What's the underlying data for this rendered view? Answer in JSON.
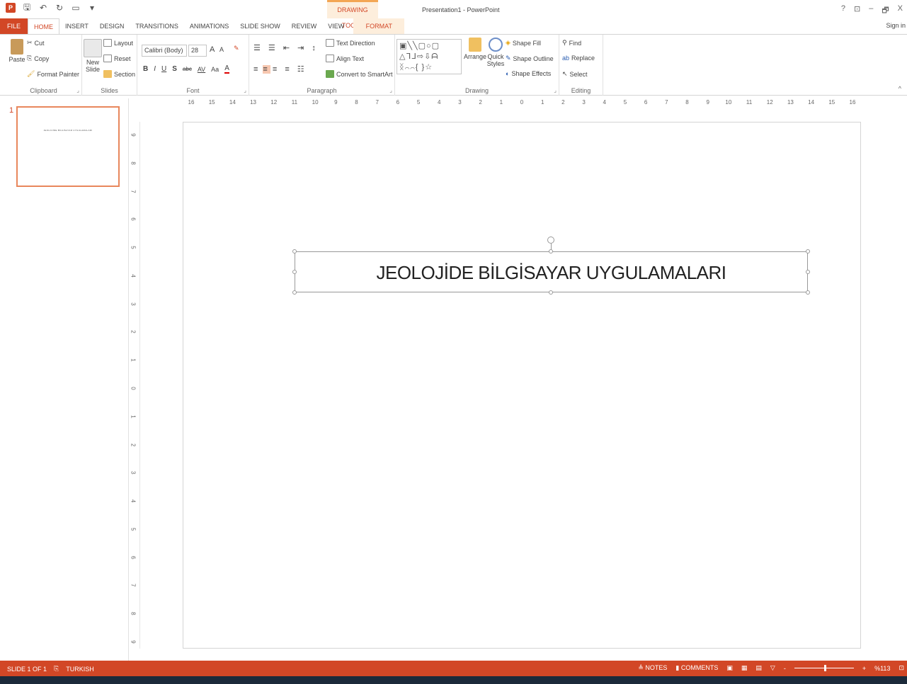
{
  "titlebar": {
    "context_tab_group": "DRAWING TOOLS",
    "doc_title": "Presentation1 - PowerPoint",
    "help": "?",
    "minimize": "–",
    "restore": "🗗",
    "close": "X"
  },
  "tabs": [
    {
      "label": "FILE"
    },
    {
      "label": "HOME"
    },
    {
      "label": "INSERT"
    },
    {
      "label": "DESIGN"
    },
    {
      "label": "TRANSITIONS"
    },
    {
      "label": "ANIMATIONS"
    },
    {
      "label": "SLIDE SHOW"
    },
    {
      "label": "REVIEW"
    },
    {
      "label": "VIEW"
    },
    {
      "label": "FORMAT"
    }
  ],
  "signin": "Sign in",
  "clipboard": {
    "paste": "Paste",
    "cut": "Cut",
    "copy": "Copy",
    "format_painter": "Format Painter",
    "label": "Clipboard"
  },
  "slides": {
    "new_slide": "New",
    "new_slide2": "Slide",
    "layout": "Layout",
    "reset": "Reset",
    "section": "Section",
    "label": "Slides"
  },
  "font": {
    "family": "Calibri (Body)",
    "size": "28",
    "bold": "B",
    "italic": "I",
    "underline": "U",
    "shadow": "S",
    "strike": "abc",
    "spacing": "AV",
    "case": "Aa",
    "color": "A",
    "label": "Font"
  },
  "paragraph": {
    "text_direction": "Text Direction",
    "align_text": "Align Text",
    "convert_smartart": "Convert to SmartArt",
    "label": "Paragraph"
  },
  "drawing": {
    "arrange": "Arrange",
    "quick_styles": "Quick",
    "quick_styles2": "Styles",
    "shape_fill": "Shape Fill",
    "shape_outline": "Shape Outline",
    "shape_effects": "Shape Effects",
    "label": "Drawing"
  },
  "editing": {
    "find": "Find",
    "replace": "Replace",
    "select": "Select",
    "label": "Editing"
  },
  "ruler": {
    "h_ticks": [
      "16",
      "15",
      "14",
      "13",
      "12",
      "11",
      "10",
      "9",
      "8",
      "7",
      "6",
      "5",
      "4",
      "3",
      "2",
      "1",
      "0",
      "1",
      "2",
      "3",
      "4",
      "5",
      "6",
      "7",
      "8",
      "9",
      "10",
      "11",
      "12",
      "13",
      "14",
      "15",
      "16"
    ],
    "v_ticks": [
      "9",
      "8",
      "7",
      "6",
      "5",
      "4",
      "3",
      "2",
      "1",
      "0",
      "1",
      "2",
      "3",
      "4",
      "5",
      "6",
      "7",
      "8",
      "9"
    ]
  },
  "thumbnail": {
    "number": "1",
    "text": "JEOLOJİDE BİLGİSAYAR UYGULAMALARI"
  },
  "slide": {
    "title": "JEOLOJİDE BİLGİSAYAR UYGULAMALARI"
  },
  "status": {
    "slide_of": "SLIDE 1 OF 1",
    "language": "TURKISH",
    "notes": "NOTES",
    "comments": "COMMENTS",
    "zoom": "%113"
  },
  "colors": {
    "accent": "#d24726",
    "context": "#fdeedc"
  }
}
